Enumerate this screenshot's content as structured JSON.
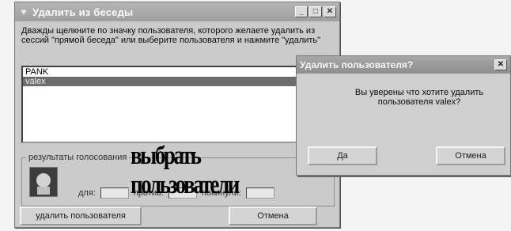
{
  "main_window": {
    "title": "Удалить из беседы",
    "instructions": "Дважды щелкните по значку пользователя, которого желаете удалить из сессий \"прямой беседа\" или выберите пользователя и нажмите \"удалить\"",
    "list_items": [
      "PANK",
      "valex"
    ],
    "selected_index": 1,
    "votes_label": "результаты голосования",
    "votes": {
      "for_label": "для:",
      "against_label": "против:",
      "left_label": "покинули:"
    },
    "overlay_stamp": "выбрать пользователи",
    "buttons": {
      "remove": "удалить пользователя",
      "cancel": "Отмена"
    }
  },
  "confirm_dialog": {
    "title": "Удалить пользователя?",
    "message": "Вы уверены что хотите удалить пользователя valex?",
    "buttons": {
      "yes": "Да",
      "cancel": "Отмена"
    }
  }
}
